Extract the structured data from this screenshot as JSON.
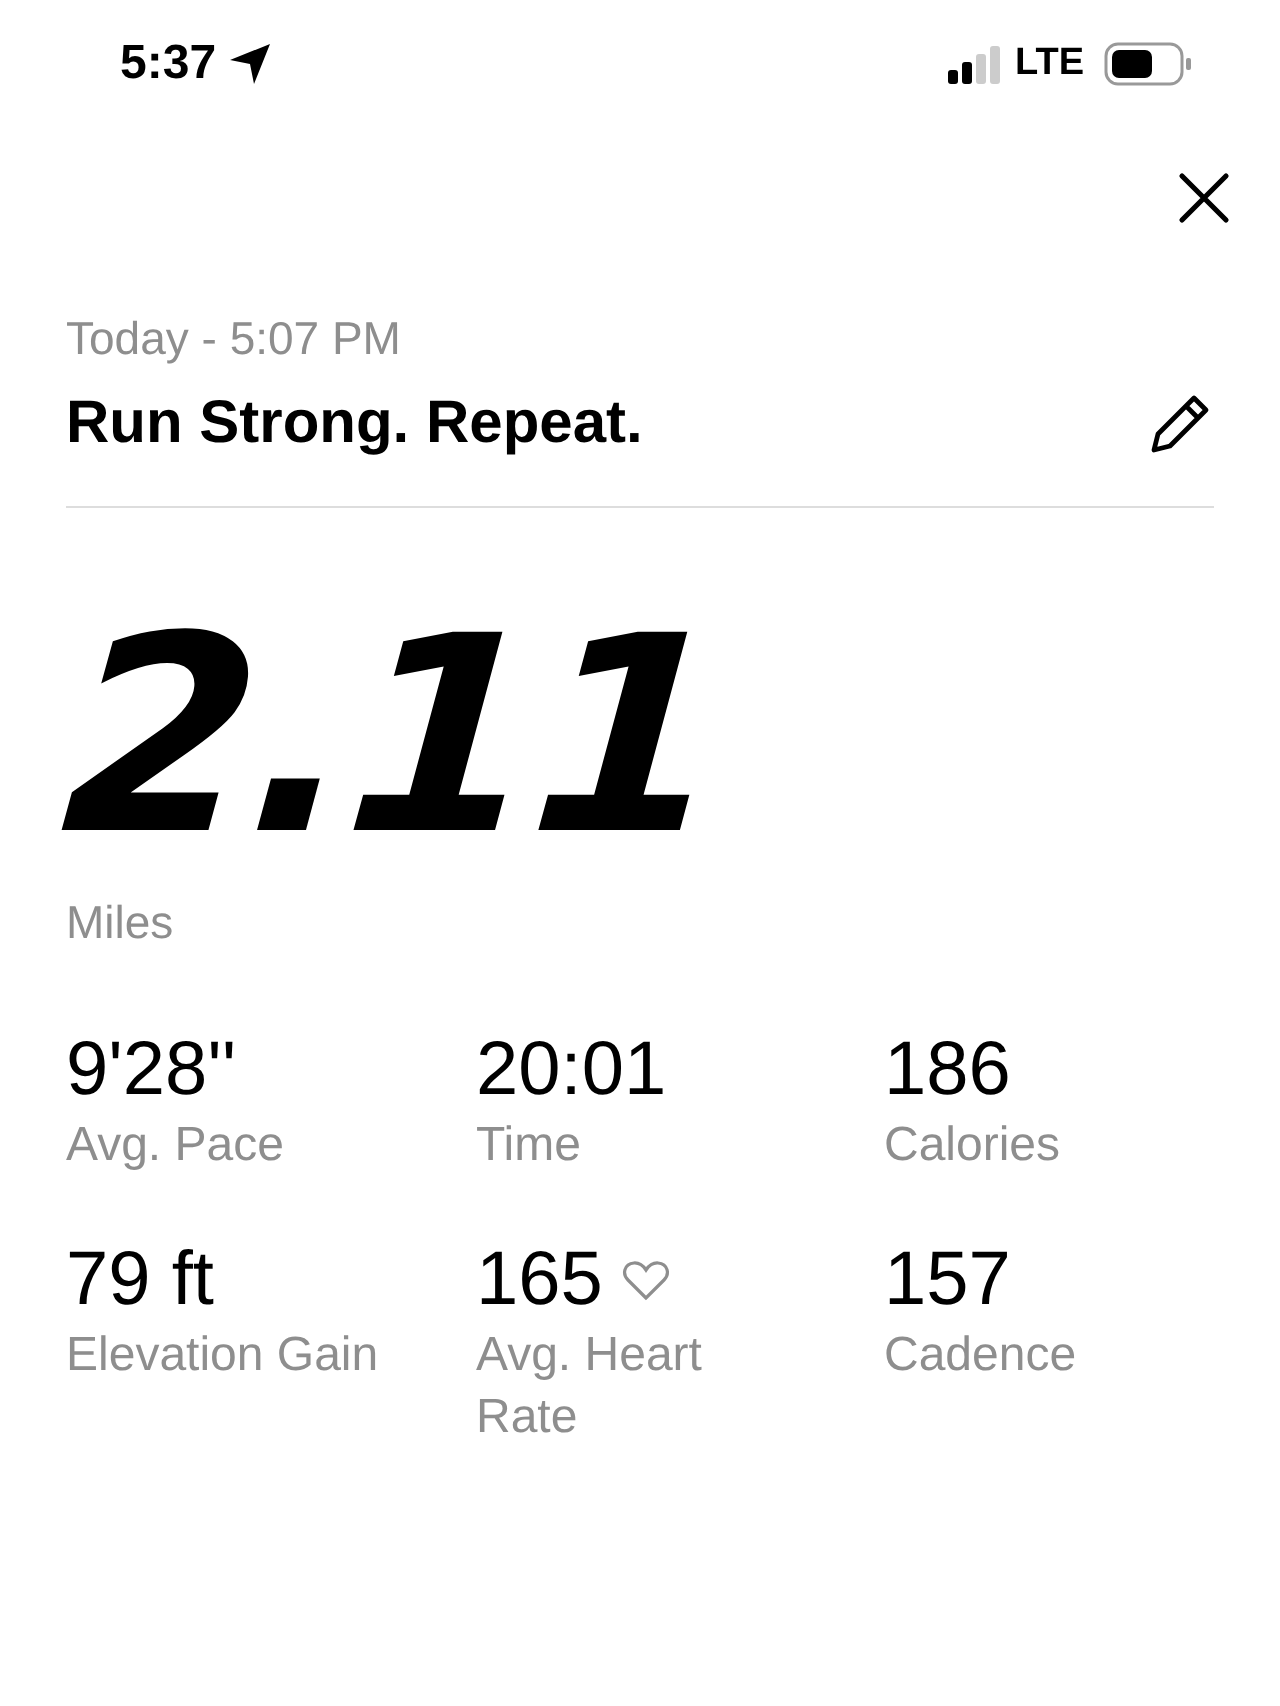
{
  "status_bar": {
    "time": "5:37",
    "network": "LTE"
  },
  "activity": {
    "date": "Today - 5:07 PM",
    "title": "Run Strong. Repeat.",
    "distance": "2.11",
    "unit": "Miles"
  },
  "stats": [
    {
      "kind": "plain",
      "value": "9'28''",
      "label": "Avg. Pace"
    },
    {
      "kind": "plain",
      "value": "20:01",
      "label": "Time"
    },
    {
      "kind": "plain",
      "value": "186",
      "label": "Calories"
    },
    {
      "kind": "plain",
      "value": "79 ft",
      "label": "Elevation Gain"
    },
    {
      "kind": "heart",
      "value": "165",
      "label": "Avg. Heart Rate"
    },
    {
      "kind": "plain",
      "value": "157",
      "label": "Cadence"
    }
  ]
}
